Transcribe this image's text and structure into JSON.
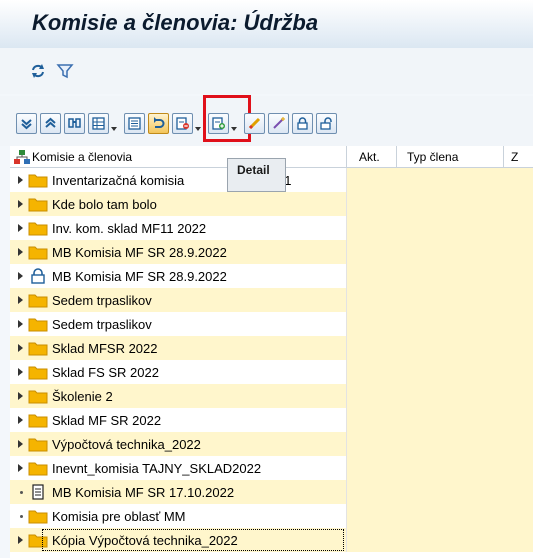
{
  "window": {
    "title": "Komisie a členovia: Údržba"
  },
  "app_toolbar": {
    "icons": [
      "refresh-icon",
      "filter-icon"
    ]
  },
  "alv_toolbar": {
    "buttons": [
      "expand-all-icon",
      "collapse-all-icon",
      "find-icon",
      "layout-icon",
      "details-list-icon",
      "detail-icon",
      "delete-icon",
      "add-icon",
      "edit-icon",
      "magic-icon",
      "lock-icon",
      "unlock-icon"
    ],
    "highlighted": "detail-icon"
  },
  "tooltip": {
    "text": "Detail"
  },
  "columns": {
    "tree": "Komisie a členovia",
    "akt": "Akt.",
    "typ": "Typ člena",
    "z": "Z"
  },
  "rows": [
    {
      "label": "Inventarizačná komisia",
      "suffix": "F11",
      "icon": "folder",
      "node": "expand",
      "alt": false
    },
    {
      "label": "Kde bolo tam bolo",
      "icon": "folder",
      "node": "expand",
      "alt": true
    },
    {
      "label": "Inv. kom. sklad MF11 2022",
      "icon": "folder",
      "node": "expand",
      "alt": false
    },
    {
      "label": "MB Komisia MF SR 28.9.2022",
      "icon": "folder",
      "node": "expand",
      "alt": true
    },
    {
      "label": "MB Komisia MF SR 28.9.2022",
      "icon": "lock",
      "node": "expand",
      "alt": false
    },
    {
      "label": "Sedem trpaslikov",
      "icon": "folder",
      "node": "expand",
      "alt": true
    },
    {
      "label": "Sedem trpaslikov",
      "icon": "folder",
      "node": "expand",
      "alt": false
    },
    {
      "label": "Sklad MFSR 2022",
      "icon": "folder",
      "node": "expand",
      "alt": true
    },
    {
      "label": "Sklad FS SR 2022",
      "icon": "folder",
      "node": "expand",
      "alt": false
    },
    {
      "label": "Školenie 2",
      "icon": "folder",
      "node": "expand",
      "alt": true
    },
    {
      "label": "Sklad MF SR 2022",
      "icon": "folder",
      "node": "expand",
      "alt": false
    },
    {
      "label": "Výpočtová technika_2022",
      "icon": "folder",
      "node": "expand",
      "alt": true
    },
    {
      "label": "Inevnt_komisia TAJNY_SKLAD2022",
      "icon": "folder",
      "node": "expand",
      "alt": false
    },
    {
      "label": "MB Komisia MF SR 17.10.2022",
      "icon": "document",
      "node": "leaf",
      "alt": true
    },
    {
      "label": "Komisia pre oblasť MM",
      "icon": "folder",
      "node": "leaf",
      "alt": false
    },
    {
      "label": "Kópia Výpočtová technika_2022",
      "icon": "folder",
      "node": "expand",
      "alt": true
    }
  ],
  "colors": {
    "folder": "#f5b400",
    "row_alt": "#fff6cc",
    "focus_red": "#e0101a"
  }
}
